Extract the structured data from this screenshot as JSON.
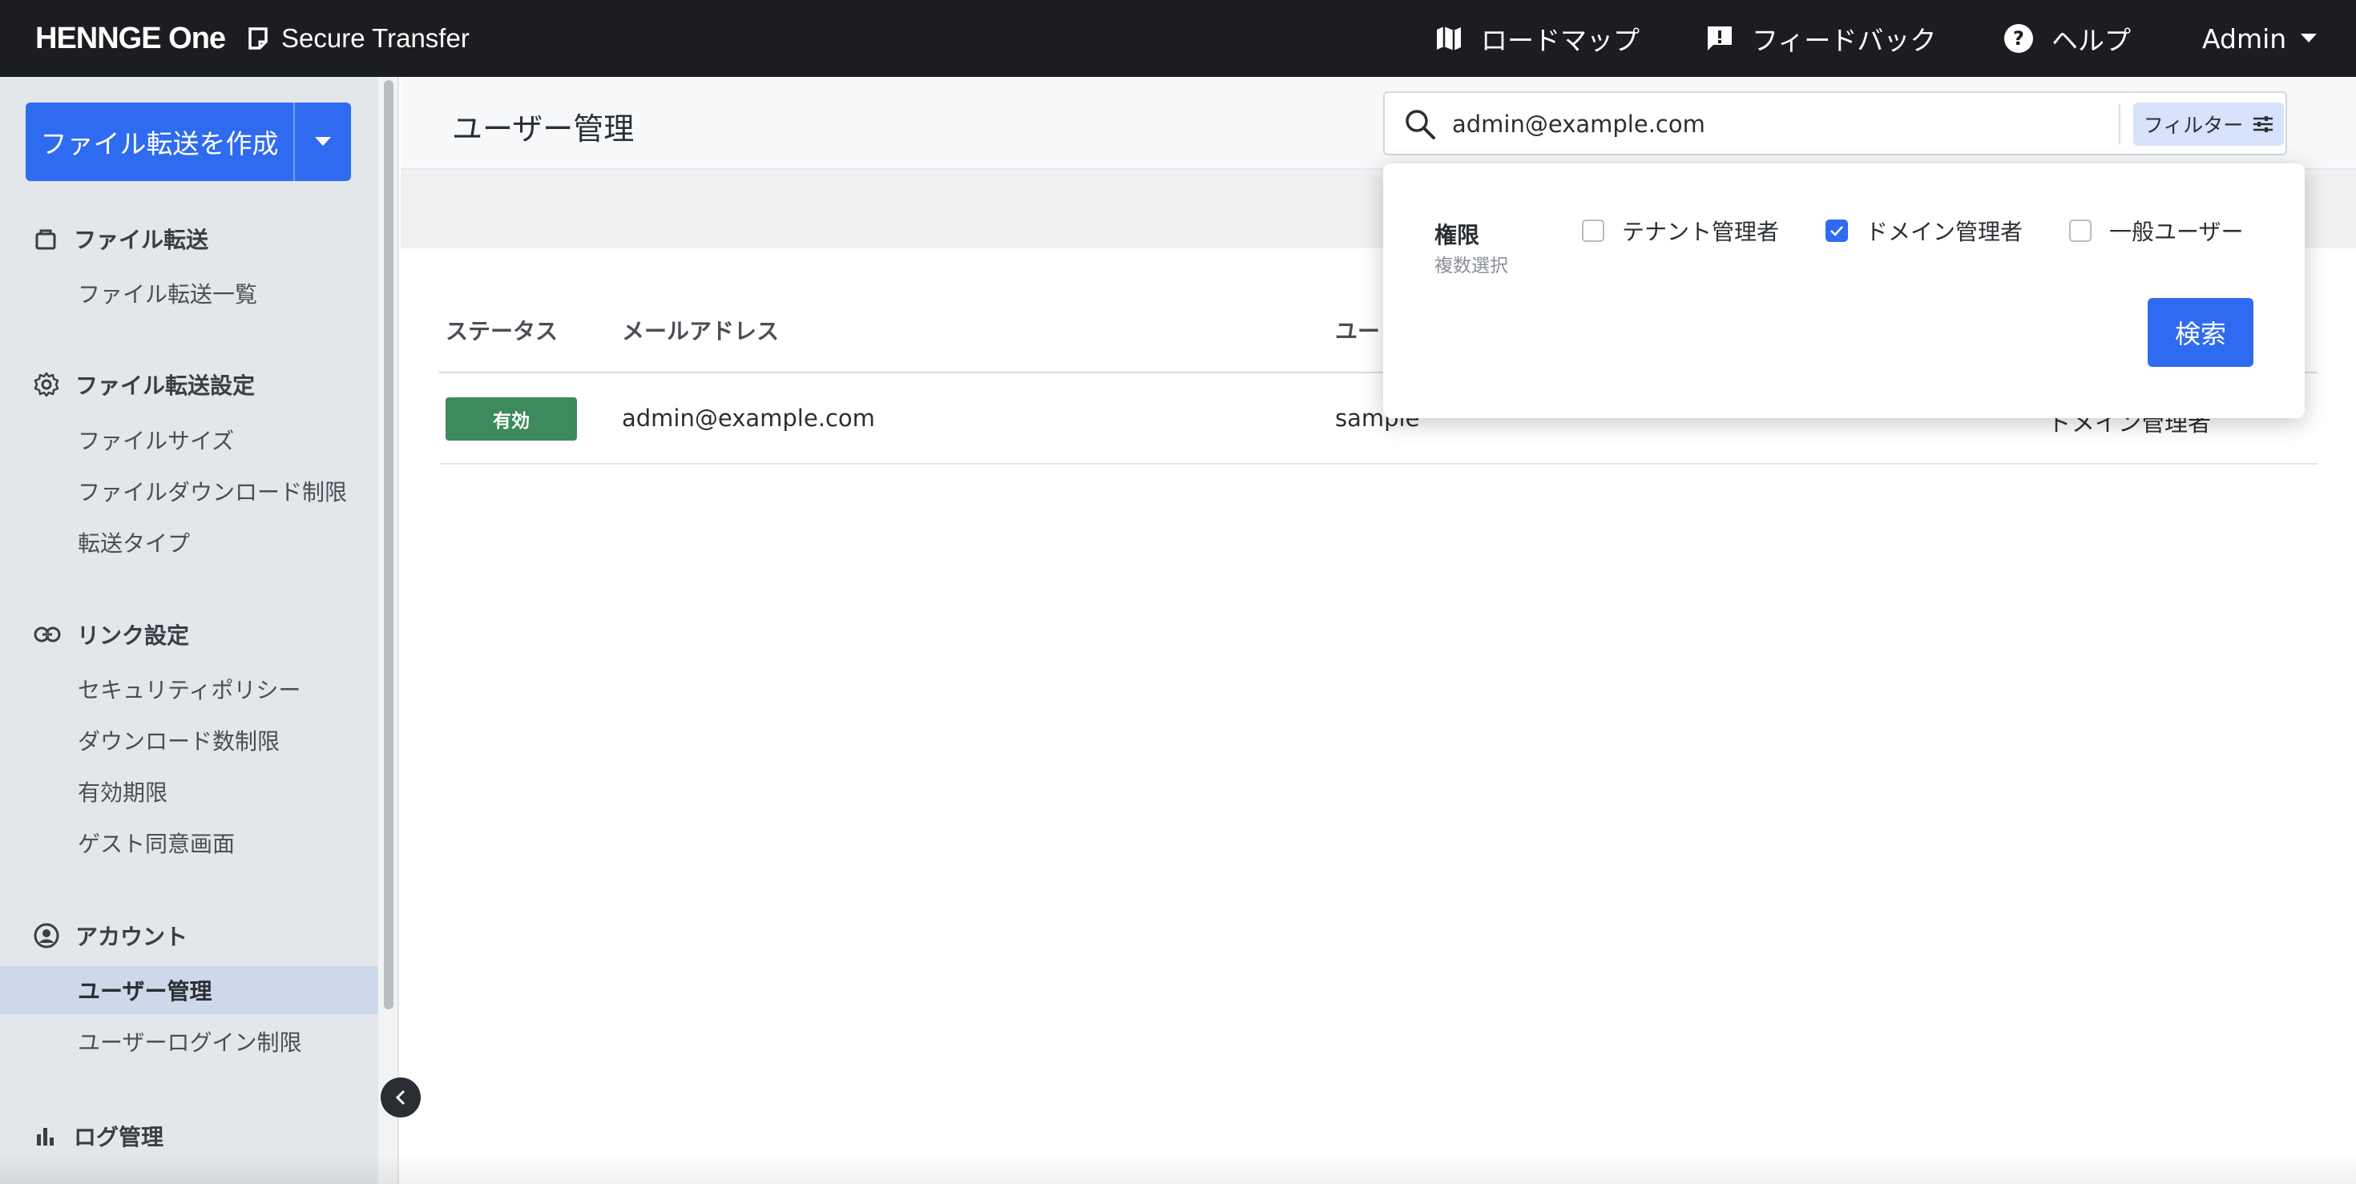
{
  "header": {
    "brand_logo": "HENNGE One",
    "product": "Secure Transfer",
    "nav": [
      {
        "label": "ロードマップ",
        "icon": "map-icon"
      },
      {
        "label": "フィードバック",
        "icon": "feedback-icon"
      },
      {
        "label": "ヘルプ",
        "icon": "help-icon"
      }
    ],
    "user": "Admin"
  },
  "sidebar": {
    "create_button": "ファイル転送を作成",
    "sections": [
      {
        "title": "ファイル転送",
        "icon": "bag-icon",
        "items": [
          "ファイル転送一覧"
        ]
      },
      {
        "title": "ファイル転送設定",
        "icon": "gear-icon",
        "items": [
          "ファイルサイズ",
          "ファイルダウンロード制限",
          "転送タイプ"
        ]
      },
      {
        "title": "リンク設定",
        "icon": "link-icon",
        "items": [
          "セキュリティポリシー",
          "ダウンロード数制限",
          "有効期限",
          "ゲスト同意画面"
        ]
      },
      {
        "title": "アカウント",
        "icon": "account-icon",
        "items": [
          "ユーザー管理",
          "ユーザーログイン制限"
        ]
      },
      {
        "title": "ログ管理",
        "icon": "bar-chart-icon",
        "items": []
      }
    ],
    "active_item": "ユーザー管理"
  },
  "main": {
    "title": "ユーザー管理",
    "search": {
      "value": "admin@example.com",
      "filter_label": "フィルター"
    },
    "table": {
      "headers": [
        "ステータス",
        "メールアドレス",
        "ユー"
      ],
      "rows": [
        {
          "status": "有効",
          "email": "admin@example.com",
          "name": "sample",
          "role": "ドメイン管理者"
        }
      ]
    }
  },
  "filter_popover": {
    "label": "権限",
    "sublabel": "複数選択",
    "options": [
      {
        "label": "テナント管理者",
        "checked": false
      },
      {
        "label": "ドメイン管理者",
        "checked": true
      },
      {
        "label": "一般ユーザー",
        "checked": false
      }
    ],
    "submit": "検索"
  },
  "colors": {
    "accent": "#2f6bf0",
    "topbar": "#1b1d20",
    "sidebar": "#e3e6ea",
    "status_active": "#3d8a5c"
  }
}
